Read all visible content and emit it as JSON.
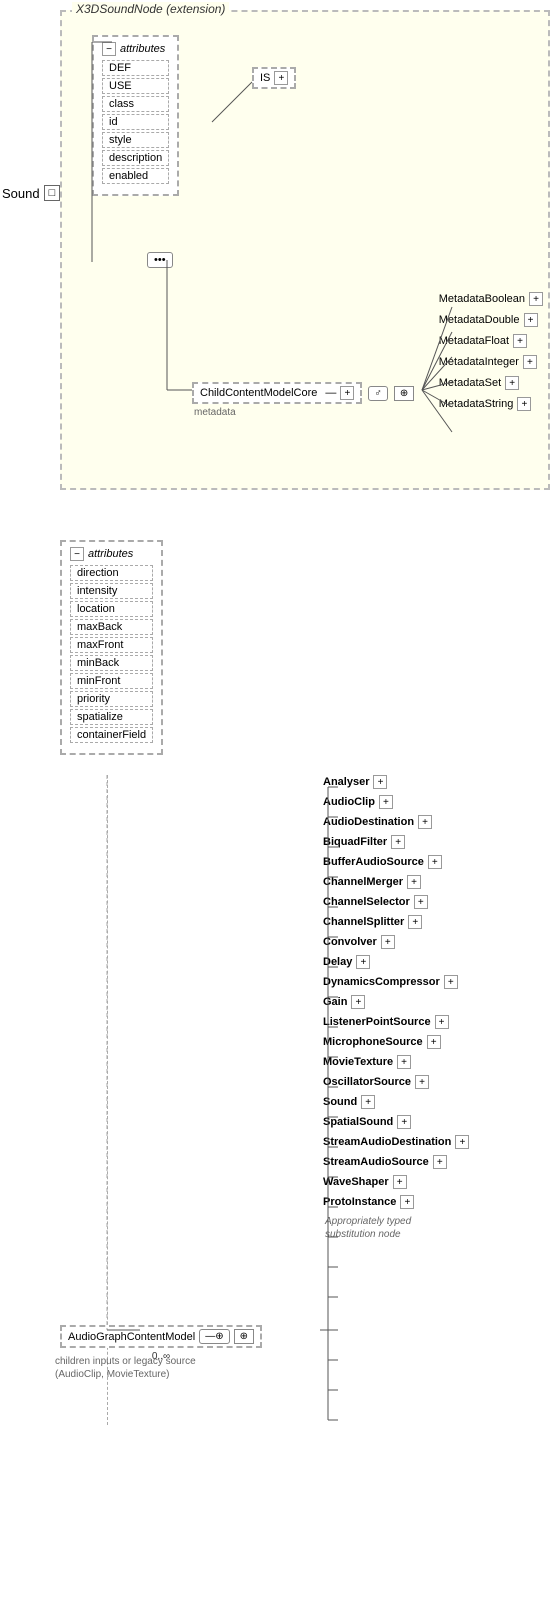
{
  "diagram": {
    "title": "X3DSoundNode (extension)",
    "sound_label": "Sound",
    "top_box": {
      "attributes_title": "attributes",
      "attrs": [
        "DEF",
        "USE",
        "class",
        "id",
        "style",
        "description",
        "enabled"
      ],
      "is_label": "IS",
      "metadata_label": "metadata",
      "child_content": "ChildContentModelCore",
      "metadata_nodes": [
        "MetadataBoolean",
        "MetadataDouble",
        "MetadataFloat",
        "MetadataInteger",
        "MetadataSet",
        "MetadataString"
      ]
    },
    "second_box": {
      "attributes_title": "attributes",
      "attrs": [
        "direction",
        "intensity",
        "location",
        "maxBack",
        "maxFront",
        "minBack",
        "minFront",
        "priority",
        "spatialize",
        "containerField"
      ]
    },
    "audio_graph": {
      "label": "AudioGraphContentModel",
      "sublabel": "children inputs or legacy source\n(AudioClip, MovieTexture)",
      "range": "0..∞",
      "nodes": [
        "Analyser",
        "AudioClip",
        "AudioDestination",
        "BiquadFilter",
        "BufferAudioSource",
        "ChannelMerger",
        "ChannelSelector",
        "ChannelSplitter",
        "Convolver",
        "Delay",
        "DynamicsCompressor",
        "Gain",
        "ListenerPointSource",
        "MicrophoneSource",
        "MovieTexture",
        "OscillatorSource",
        "Sound",
        "SpatialSound",
        "StreamAudioDestination",
        "StreamAudioSource",
        "WaveShaper",
        "ProtoInstance"
      ],
      "proto_note": "Appropriately typed\nsubstitution node"
    }
  }
}
